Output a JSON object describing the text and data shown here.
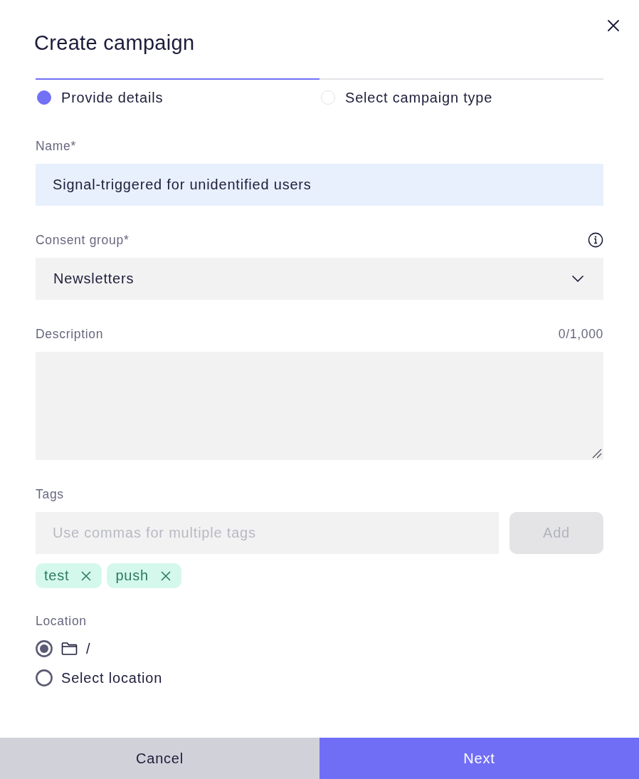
{
  "dialog": {
    "title": "Create campaign"
  },
  "steps": [
    {
      "label": "Provide details",
      "selected": true
    },
    {
      "label": "Select campaign type",
      "selected": false
    }
  ],
  "name_field": {
    "label": "Name*",
    "value": "Signal-triggered for unidentified users"
  },
  "consent_group": {
    "label": "Consent group*",
    "value": "Newsletters"
  },
  "description": {
    "label": "Description",
    "counter": "0/1,000"
  },
  "tags": {
    "label": "Tags",
    "placeholder": "Use commas for multiple tags",
    "add_button": {
      "label": "Add",
      "disabled": true
    },
    "items": [
      {
        "label": "test"
      },
      {
        "label": "push"
      }
    ]
  },
  "location": {
    "label": "Location",
    "options": [
      {
        "kind": "folder",
        "label": "/",
        "selected": true
      },
      {
        "kind": "plain",
        "label": "Select location",
        "selected": false
      }
    ]
  },
  "footer": {
    "buttons": [
      {
        "kind": "secondary",
        "label": "Cancel"
      },
      {
        "kind": "primary",
        "label": "Next"
      }
    ]
  }
}
